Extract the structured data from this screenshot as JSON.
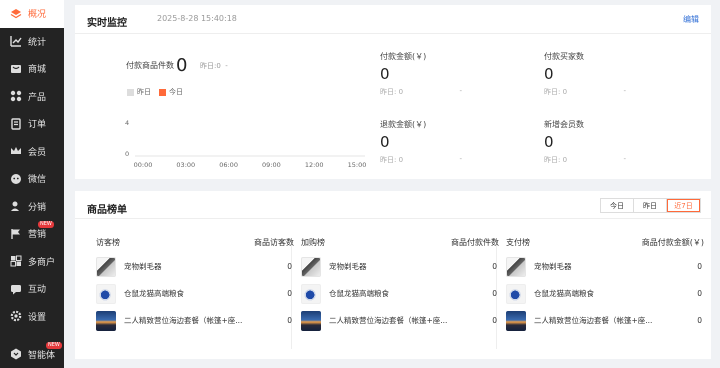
{
  "sidebar": {
    "items": [
      {
        "label": "概况",
        "icon": "layers-icon",
        "active": true
      },
      {
        "label": "统计",
        "icon": "stats-icon"
      },
      {
        "label": "商城",
        "icon": "mall-icon"
      },
      {
        "label": "产品",
        "icon": "grid-icon"
      },
      {
        "label": "订单",
        "icon": "order-icon"
      },
      {
        "label": "会员",
        "icon": "crown-icon"
      },
      {
        "label": "微信",
        "icon": "wechat-icon"
      },
      {
        "label": "分销",
        "icon": "share-icon"
      },
      {
        "label": "营销",
        "icon": "flag-icon",
        "badge": "NEW"
      },
      {
        "label": "多商户",
        "icon": "merchant-icon"
      },
      {
        "label": "互动",
        "icon": "chat-icon"
      },
      {
        "label": "设置",
        "icon": "gear-icon"
      }
    ],
    "bottom": {
      "label": "智能体",
      "icon": "agent-icon",
      "badge": "NEW"
    }
  },
  "realtime": {
    "title": "实时监控",
    "datetime": "2025-8-28 15:40:18",
    "edit": "编辑",
    "pay_goods_label": "付款商品件数",
    "pay_goods_value": "0",
    "pay_goods_yesterday": "昨日:0",
    "pay_goods_dash": "-",
    "legend": [
      {
        "label": "昨日",
        "color": "#dddddd"
      },
      {
        "label": "今日",
        "color": "#ff6a3a"
      }
    ],
    "chart_y_ticks": [
      "4",
      "0"
    ],
    "chart_x_ticks": [
      "00:00",
      "03:00",
      "06:00",
      "09:00",
      "12:00",
      "15:00"
    ],
    "metrics": [
      {
        "label": "付款金额(￥)",
        "value": "0",
        "yesterday": "昨日: 0",
        "dash": "-"
      },
      {
        "label": "付款买家数",
        "value": "0",
        "yesterday": "昨日: 0",
        "dash": "-"
      },
      {
        "label": "退款金额(￥)",
        "value": "0",
        "yesterday": "昨日: 0",
        "dash": "-"
      },
      {
        "label": "新增会员数",
        "value": "0",
        "yesterday": "昨日: 0",
        "dash": "-"
      }
    ]
  },
  "ranking": {
    "title": "商品榜单",
    "tabs": [
      {
        "label": "今日"
      },
      {
        "label": "昨日"
      },
      {
        "label": "近7日",
        "active": true
      }
    ],
    "columns": [
      {
        "name": "访客榜",
        "metric": "商品访客数",
        "rows": [
          {
            "name": "宠物剃毛器",
            "value": "0"
          },
          {
            "name": "仓鼠龙猫高端粮食",
            "value": "0"
          },
          {
            "name": "二人精致营位海边套餐（帐篷+座...",
            "value": "0"
          }
        ]
      },
      {
        "name": "加购榜",
        "metric": "商品付款件数",
        "rows": [
          {
            "name": "宠物剃毛器",
            "value": "0"
          },
          {
            "name": "仓鼠龙猫高端粮食",
            "value": "0"
          },
          {
            "name": "二人精致营位海边套餐（帐篷+座...",
            "value": "0"
          }
        ]
      },
      {
        "name": "支付榜",
        "metric": "商品付款金额(￥)",
        "rows": [
          {
            "name": "宠物剃毛器",
            "value": "0"
          },
          {
            "name": "仓鼠龙猫高端粮食",
            "value": "0"
          },
          {
            "name": "二人精致营位海边套餐（帐篷+座...",
            "value": "0"
          }
        ]
      }
    ]
  }
}
